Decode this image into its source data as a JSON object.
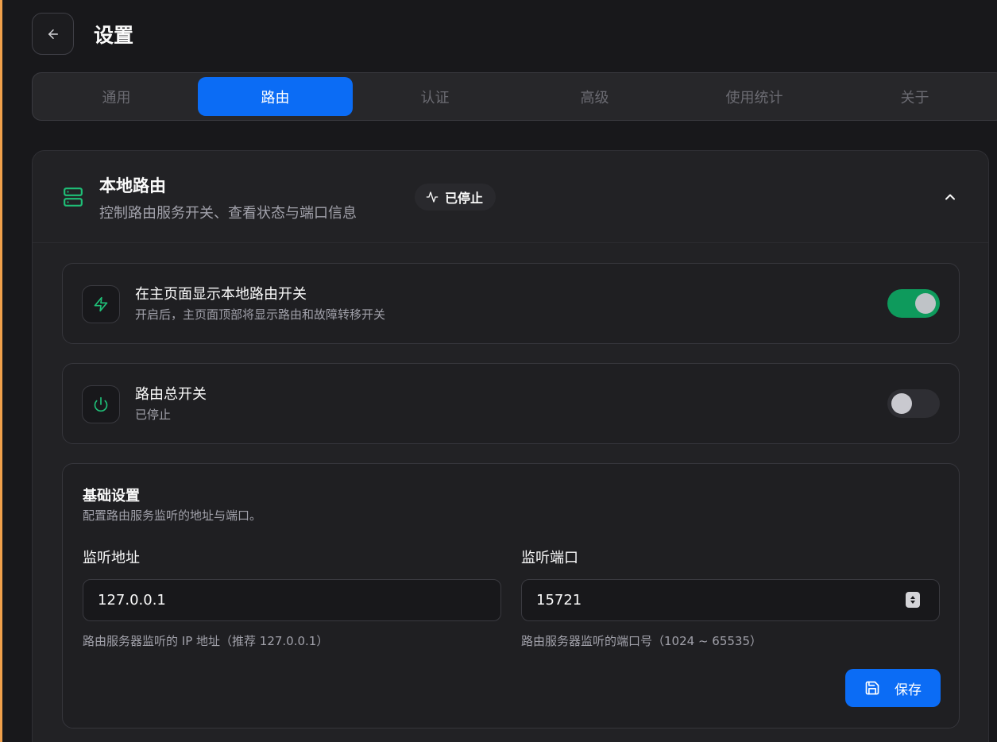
{
  "colors": {
    "accent": "#0b6cf5",
    "success": "#0e9a5c",
    "background": "#18181b",
    "card": "#222225"
  },
  "header": {
    "back_icon": "arrow-left-icon",
    "title": "设置"
  },
  "tabs": [
    {
      "label": "通用",
      "active": false
    },
    {
      "label": "路由",
      "active": true
    },
    {
      "label": "认证",
      "active": false
    },
    {
      "label": "高级",
      "active": false
    },
    {
      "label": "使用统计",
      "active": false
    },
    {
      "label": "关于",
      "active": false
    }
  ],
  "local_router": {
    "icon": "server-icon",
    "title": "本地路由",
    "subtitle": "控制路由服务开关、查看状态与端口信息",
    "status": {
      "icon": "activity-icon",
      "label": "已停止"
    },
    "collapse_icon": "chevron-up-icon",
    "show_switch": {
      "icon": "zap-icon",
      "title": "在主页面显示本地路由开关",
      "description": "开启后，主页面顶部将显示路由和故障转移开关",
      "enabled": true
    },
    "master_switch": {
      "icon": "power-icon",
      "title": "路由总开关",
      "description": "已停止",
      "enabled": false
    }
  },
  "basic_settings": {
    "title": "基础设置",
    "description": "配置路由服务监听的地址与端口。",
    "listen_address": {
      "label": "监听地址",
      "value": "127.0.0.1",
      "hint": "路由服务器监听的 IP 地址（推荐 127.0.0.1）"
    },
    "listen_port": {
      "label": "监听端口",
      "value": "15721",
      "hint": "路由服务器监听的端口号（1024 ~ 65535）"
    },
    "save": {
      "icon": "save-icon",
      "label": "保存"
    }
  }
}
